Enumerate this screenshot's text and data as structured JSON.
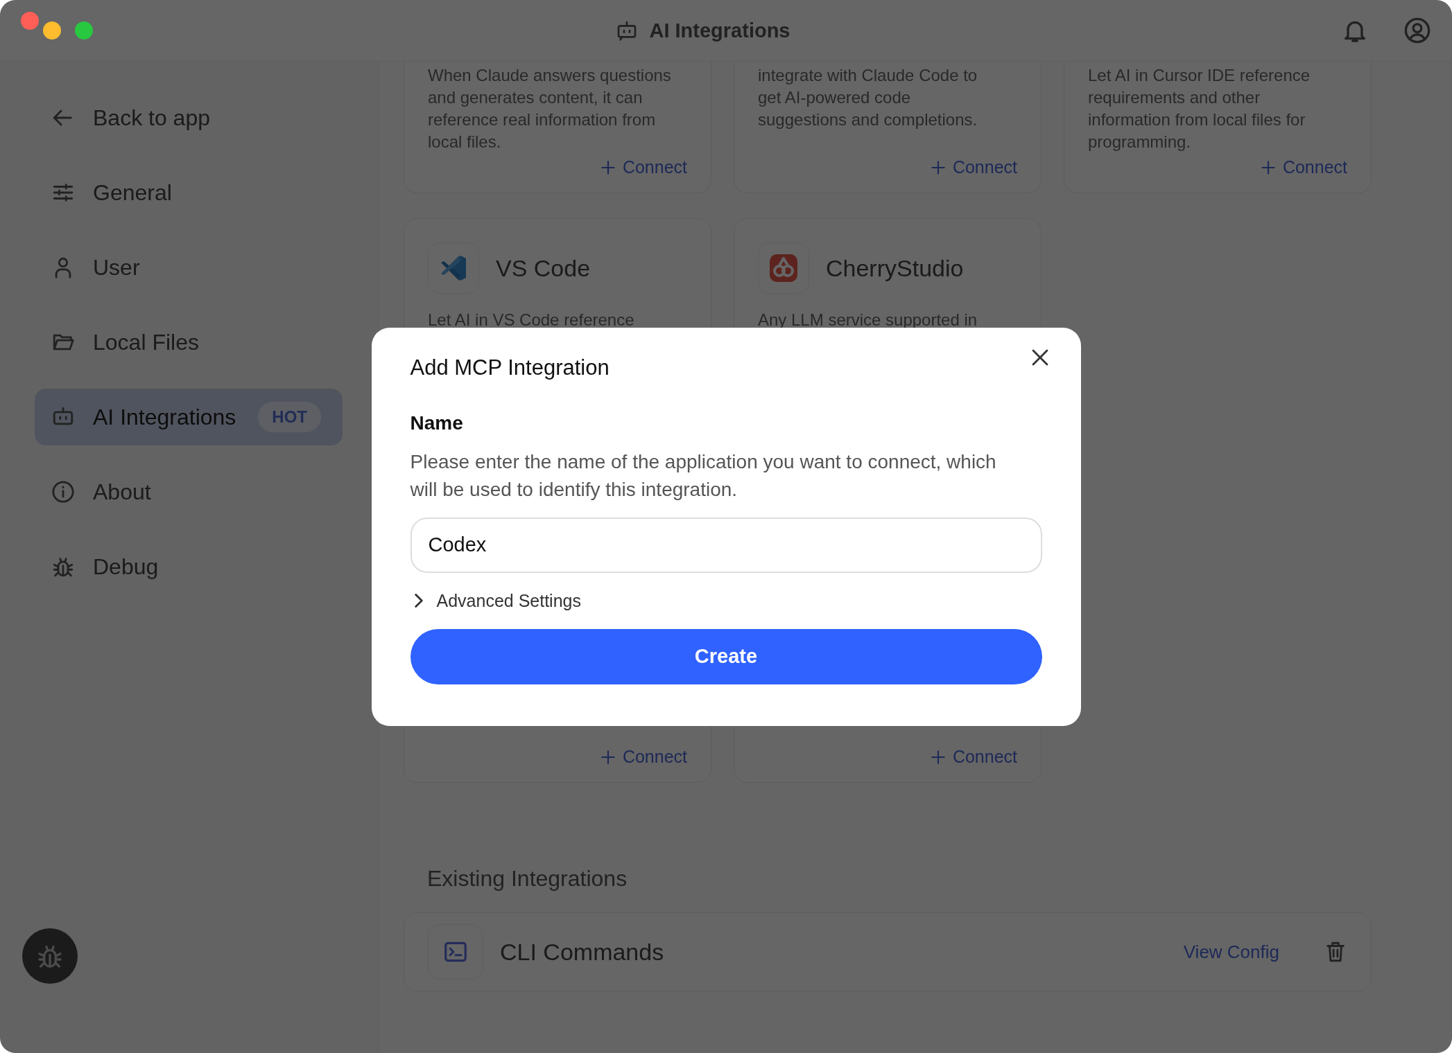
{
  "window": {
    "title": "AI Integrations"
  },
  "sidebar": {
    "back": "Back to app",
    "items": [
      {
        "label": "General",
        "selected": false
      },
      {
        "label": "User",
        "selected": false
      },
      {
        "label": "Local Files",
        "selected": false
      },
      {
        "label": "AI Integrations",
        "selected": true,
        "badge": "HOT"
      },
      {
        "label": "About",
        "selected": false
      },
      {
        "label": "Debug",
        "selected": false
      }
    ]
  },
  "cards": [
    {
      "description": [
        "When Claude answers questions",
        "and generates content, it can",
        "reference real information from",
        "local files."
      ],
      "action": "Connect"
    },
    {
      "description": [
        "integrate with Claude Code to",
        "get AI-powered code",
        "suggestions and completions."
      ],
      "action": "Connect"
    },
    {
      "description": [
        "Let AI in Cursor IDE reference",
        "requirements and other",
        "information from local files for",
        "programming."
      ],
      "action": "Connect"
    },
    {
      "name": "VS Code",
      "description": [
        "Let AI in VS Code reference"
      ],
      "action": "Connect"
    },
    {
      "name": "CherryStudio",
      "description": [
        "Any LLM service supported in"
      ],
      "action": "Connect"
    }
  ],
  "existing": {
    "heading": "Existing Integrations",
    "items": [
      {
        "name": "CLI Commands",
        "action": "View Config"
      }
    ]
  },
  "dialog": {
    "title": "Add MCP Integration",
    "field_label": "Name",
    "help": "Please enter the name of the application you want to connect, which will be used to identify this integration.",
    "value": "Codex",
    "advanced": {
      "label": "Advanced Settings",
      "expanded": false
    },
    "submit": "Create"
  }
}
